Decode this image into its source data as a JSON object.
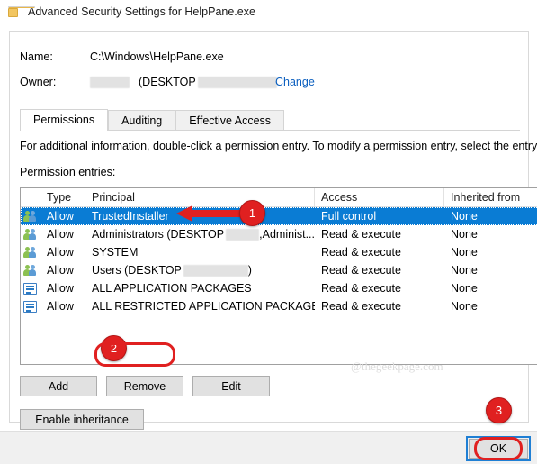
{
  "window": {
    "title": "Advanced Security Settings for HelpPane.exe",
    "icon": "folder-icon"
  },
  "header": {
    "name_label": "Name:",
    "name_value": "C:\\Windows\\HelpPane.exe",
    "owner_label": "Owner:",
    "owner_value_prefix": "",
    "owner_value_middle": "(DESKTOP",
    "owner_redacted": true,
    "change_link": "Change"
  },
  "tabs": [
    {
      "label": "Permissions",
      "selected": true
    },
    {
      "label": "Auditing",
      "selected": false
    },
    {
      "label": "Effective Access",
      "selected": false
    }
  ],
  "info_text": "For additional information, double-click a permission entry. To modify a permission entry, select the entry and",
  "entries_label": "Permission entries:",
  "table": {
    "columns": [
      "Type",
      "Principal",
      "Access",
      "Inherited from"
    ],
    "rows": [
      {
        "icon": "users-icon",
        "type": "Allow",
        "principal": "TrustedInstaller",
        "access": "Full control",
        "inherited_from": "None",
        "selected": true
      },
      {
        "icon": "users-icon",
        "type": "Allow",
        "principal": "Administrators (DESKTOP",
        "principal_suffix": ",Administ...",
        "access": "Read & execute",
        "inherited_from": "None",
        "selected": false
      },
      {
        "icon": "users-icon",
        "type": "Allow",
        "principal": "SYSTEM",
        "access": "Read & execute",
        "inherited_from": "None",
        "selected": false
      },
      {
        "icon": "users-icon",
        "type": "Allow",
        "principal": "Users (DESKTOP",
        "principal_suffix": ")",
        "access": "Read & execute",
        "inherited_from": "None",
        "selected": false
      },
      {
        "icon": "app-package-icon",
        "type": "Allow",
        "principal": "ALL APPLICATION PACKAGES",
        "access": "Read & execute",
        "inherited_from": "None",
        "selected": false
      },
      {
        "icon": "app-package-icon",
        "type": "Allow",
        "principal": "ALL RESTRICTED APPLICATION PACKAGES",
        "access": "Read & execute",
        "inherited_from": "None",
        "selected": false
      }
    ]
  },
  "buttons": {
    "add": "Add",
    "remove": "Remove",
    "edit": "Edit",
    "enable_inheritance": "Enable inheritance",
    "ok": "OK"
  },
  "annotations": {
    "badge_1": "1",
    "badge_2": "2",
    "badge_3": "3",
    "arrow_color": "#e02020",
    "highlight_color": "#e02020"
  },
  "watermark": "@thegeekpage.com",
  "colors": {
    "selection_blue": "#0a7cd4",
    "link_blue": "#0b5fbf",
    "focus_blue": "#1f7fd4",
    "annotation_red": "#e02020",
    "button_face": "#e1e1e1"
  }
}
